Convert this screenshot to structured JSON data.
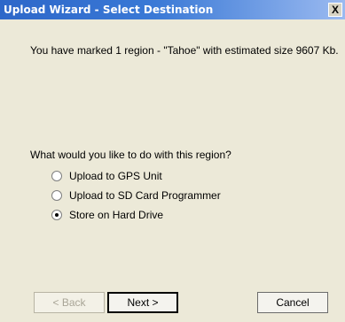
{
  "window": {
    "title": "Upload Wizard - Select Destination",
    "close_label": "X"
  },
  "message": "You have marked 1 region - \"Tahoe\" with estimated size 9607 Kb.",
  "question": "What would you like to do with this region?",
  "options": [
    {
      "label": "Upload to GPS Unit",
      "selected": false
    },
    {
      "label": "Upload to SD Card Programmer",
      "selected": false
    },
    {
      "label": "Store on Hard Drive",
      "selected": true
    }
  ],
  "buttons": {
    "back": "< Back",
    "next": "Next >",
    "cancel": "Cancel"
  }
}
